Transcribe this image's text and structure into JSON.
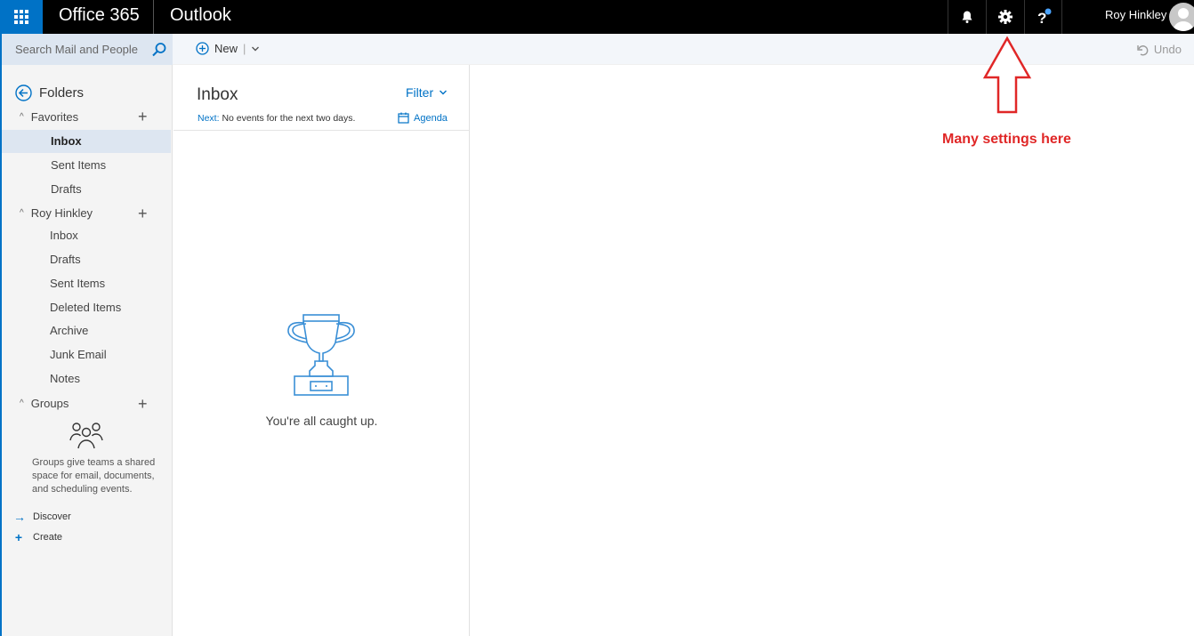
{
  "topbar": {
    "brand": "Office 365",
    "app": "Outlook",
    "user_name": "Roy Hinkley",
    "icons": [
      "bell-icon",
      "gear-icon",
      "help-icon"
    ]
  },
  "search": {
    "placeholder": "Search Mail and People"
  },
  "commands": {
    "new_label": "New",
    "undo_label": "Undo"
  },
  "sidebar": {
    "folders_label": "Folders",
    "favorites": {
      "label": "Favorites",
      "items": [
        {
          "label": "Inbox",
          "selected": true
        },
        {
          "label": "Sent Items"
        },
        {
          "label": "Drafts"
        }
      ]
    },
    "account": {
      "label": "Roy Hinkley",
      "items": [
        {
          "label": "Inbox"
        },
        {
          "label": "Drafts"
        },
        {
          "label": "Sent Items"
        },
        {
          "label": "Deleted Items"
        },
        {
          "label": "Archive"
        },
        {
          "label": "Junk Email"
        },
        {
          "label": "Notes"
        }
      ]
    },
    "groups": {
      "label": "Groups",
      "description": "Groups give teams a shared space for email, documents, and scheduling events.",
      "discover_label": "Discover",
      "create_label": "Create"
    }
  },
  "message_list": {
    "title": "Inbox",
    "filter_label": "Filter",
    "next_label": "Next:",
    "next_text": "No events for the next two days.",
    "agenda_label": "Agenda",
    "empty_text": "You're all caught up."
  },
  "annotation": {
    "text": "Many settings here",
    "color": "#e02727"
  },
  "colors": {
    "brand_blue": "#0072c6",
    "topbar": "#000000",
    "selected_bg": "#dde6f1"
  }
}
